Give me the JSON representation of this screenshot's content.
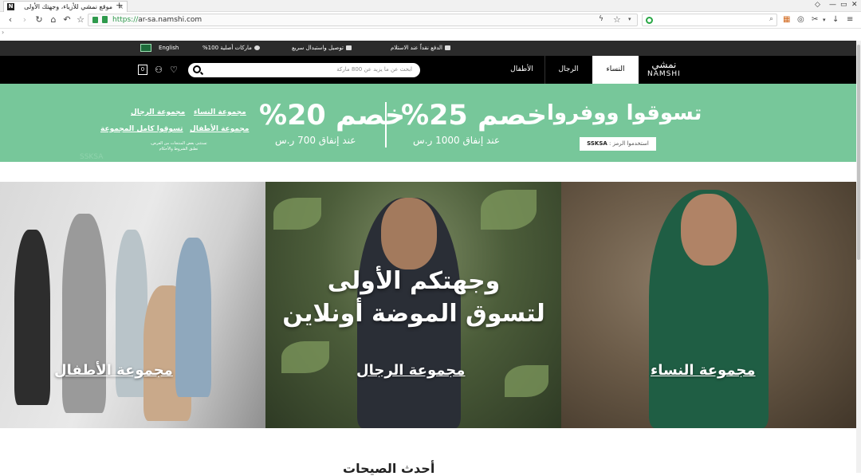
{
  "browser": {
    "tab_title": "موقع نمشي للأزياء، وجهتك الأولى",
    "tab_favicon": "N",
    "tab_close": "×",
    "new_tab": "+",
    "url_protocol": "https://",
    "url_host": "ar-sa.namshi.com",
    "icons": [
      "back-icon",
      "forward-icon",
      "reload-icon",
      "home-icon",
      "undo-icon",
      "star-icon",
      "shield-icon",
      "lock-icon",
      "bolt-icon",
      "bookmark-star-icon",
      "dropdown-icon",
      "search-engine-icon",
      "magnifier-icon",
      "extensions-icon",
      "gamepad-icon",
      "scissors-icon",
      "download-icon",
      "menu-icon"
    ]
  },
  "infobar": {
    "cod": "الدفع نقداً عند الاستلام",
    "delivery": "توصيل واستبدال سريع",
    "authentic": "ماركات أصلية 100%",
    "language": "English"
  },
  "nav": {
    "logo_ar": "نمشي",
    "logo_en": "NAMSHI",
    "tabs": [
      "النساء",
      "الرجال",
      "الأطفال"
    ],
    "active_tab": "النساء",
    "search_placeholder": "ابحث عن ما يزيد عن 800 ماركة",
    "cart_count": "0"
  },
  "promo": {
    "headline": "تسوقوا ووفروا",
    "code_label": "استخدموا الرمز :",
    "code": "SSKSA",
    "deal1_big": "خصم 25%",
    "deal1_small": "عند إنفاق 1000 ر.س",
    "deal2_big": "خصم 20%",
    "deal2_small": "عند إنفاق 700 ر.س",
    "links": {
      "women": "مجموعة النساء",
      "men": "مجموعة الرجال",
      "kids": "مجموعة الأطفال",
      "all": "تسوقوا كامل المجموعة"
    },
    "note": "تستثنى بعض المنتجات من العرض، تطبق الشروط والأحكام",
    "faint_text": "SSKSA"
  },
  "hero": {
    "headline_line1": "وجهتكم الأولى",
    "headline_line2": "لتسوق الموضة أونلاين",
    "kids_cta": "مجموعة الأطفال",
    "men_cta": "مجموعة الرجال",
    "women_cta": "مجموعة النساء"
  },
  "below": {
    "section_title": "أحدث الصيحات"
  },
  "colors": {
    "promo_green": "#77c79a",
    "nav_black": "#000000",
    "infobar": "#2b2b2b"
  }
}
